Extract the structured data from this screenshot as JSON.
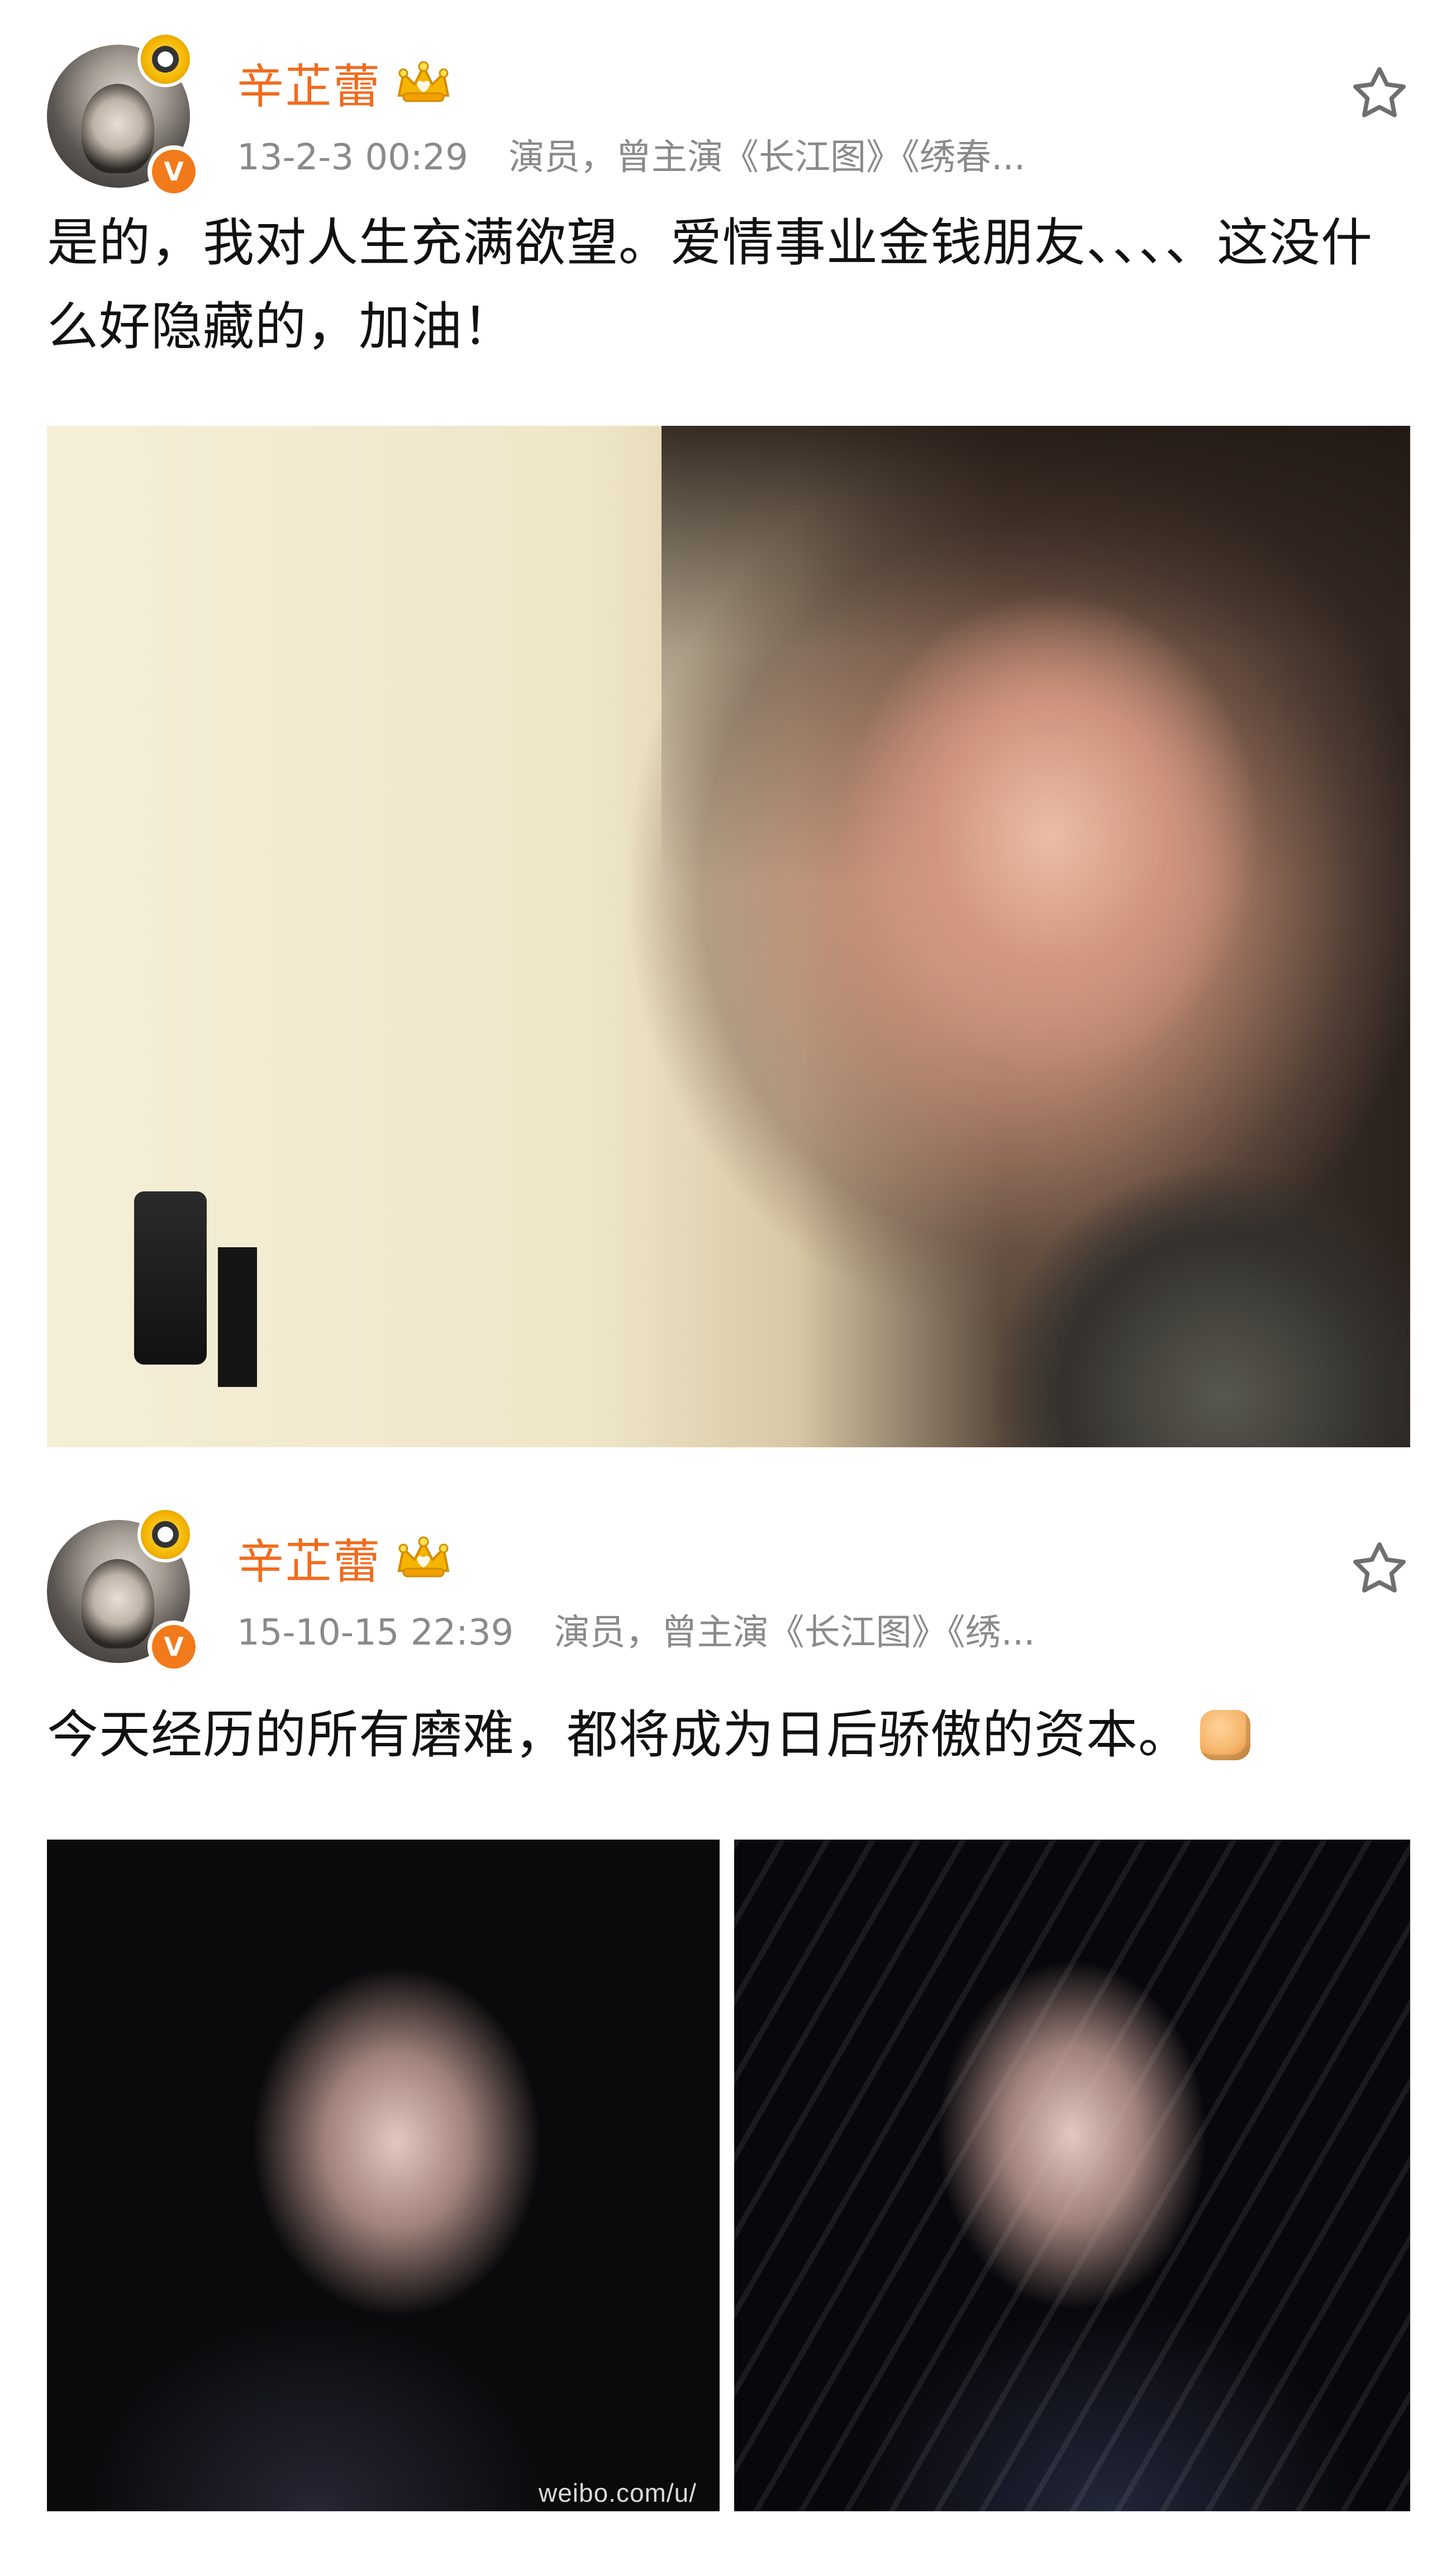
{
  "posts": [
    {
      "user": {
        "name": "辛芷蕾"
      },
      "meta": {
        "time": "13-2-3 00:29",
        "info": "演员，曾主演《长江图》《绣春..."
      },
      "text": "是的，我对人生充满欲望。爱情事业金钱朋友、、、、这没什么好隐藏的，加油！",
      "icons": {
        "crown": "crown-icon",
        "star": "star-icon",
        "badge": "verified-v-badge-icon"
      }
    },
    {
      "user": {
        "name": "辛芷蕾"
      },
      "meta": {
        "time": "15-10-15 22:39",
        "info": "演员，曾主演《长江图》《绣..."
      },
      "text": "今天经历的所有磨难，都将成为日后骄傲的资本。",
      "emoji": "fist-emoji",
      "watermark": "weibo.com/u/",
      "icons": {
        "crown": "crown-icon",
        "star": "star-icon",
        "badge": "verified-v-badge-icon"
      }
    }
  ],
  "badge_letter": "V",
  "colors": {
    "username": "#f26b1d",
    "meta": "#8a8a8a",
    "badge": "#f27a1a",
    "text": "#111111",
    "background": "#ffffff"
  }
}
